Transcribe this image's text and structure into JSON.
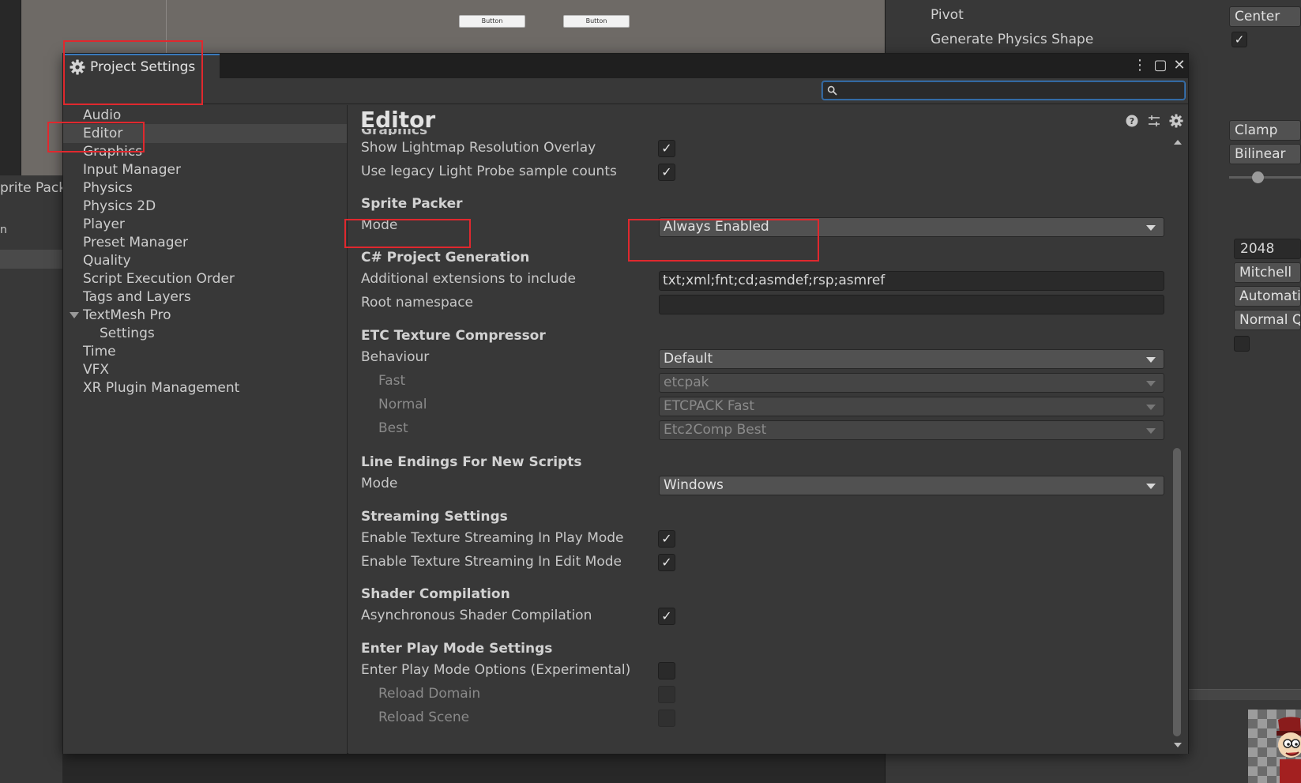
{
  "background": {
    "scene_buttons": [
      "Button",
      "Button"
    ],
    "left_strip_label": "prite Pack",
    "left_strip_tab": "n",
    "inspector": {
      "pivot_label": "Pivot",
      "pivot_value": "Center",
      "physics_shape_label": "Generate Physics Shape",
      "physics_shape_checked": "✓",
      "wrap_value": "Clamp",
      "filter_value": "Bilinear",
      "max_size": "2048",
      "resize": "Mitchell",
      "format": "Automatic",
      "compression": "Normal Q"
    }
  },
  "window": {
    "title": "Project Settings",
    "menu_glyph": "⋮",
    "maximize_glyph": "▢",
    "close_glyph": "✕",
    "search_placeholder": ""
  },
  "sidebar": {
    "items": [
      {
        "label": "Audio"
      },
      {
        "label": "Editor",
        "selected": true
      },
      {
        "label": "Graphics"
      },
      {
        "label": "Input Manager"
      },
      {
        "label": "Physics"
      },
      {
        "label": "Physics 2D"
      },
      {
        "label": "Player"
      },
      {
        "label": "Preset Manager"
      },
      {
        "label": "Quality"
      },
      {
        "label": "Script Execution Order"
      },
      {
        "label": "Tags and Layers"
      },
      {
        "label": "TextMesh Pro"
      },
      {
        "label": "Settings"
      },
      {
        "label": "Time"
      },
      {
        "label": "VFX"
      },
      {
        "label": "XR Plugin Management"
      }
    ]
  },
  "editor": {
    "title": "Editor",
    "cut_section": "Graphics",
    "graphics": {
      "lightmap_overlay": "Show Lightmap Resolution Overlay",
      "legacy_light_probe": "Use legacy Light Probe sample counts"
    },
    "sprite_packer": {
      "header": "Sprite Packer",
      "mode_label": "Mode",
      "mode_value": "Always Enabled"
    },
    "csharp": {
      "header": "C# Project Generation",
      "ext_label": "Additional extensions to include",
      "ext_value": "txt;xml;fnt;cd;asmdef;rsp;asmref",
      "ns_label": "Root namespace",
      "ns_value": ""
    },
    "etc": {
      "header": "ETC Texture Compressor",
      "behaviour_label": "Behaviour",
      "behaviour_value": "Default",
      "fast_label": "Fast",
      "fast_value": "etcpak",
      "normal_label": "Normal",
      "normal_value": "ETCPACK Fast",
      "best_label": "Best",
      "best_value": "Etc2Comp Best"
    },
    "line_endings": {
      "header": "Line Endings For New Scripts",
      "mode_label": "Mode",
      "mode_value": "Windows"
    },
    "streaming": {
      "header": "Streaming Settings",
      "play_label": "Enable Texture Streaming In Play Mode",
      "edit_label": "Enable Texture Streaming In Edit Mode"
    },
    "shader": {
      "header": "Shader Compilation",
      "async_label": "Asynchronous Shader Compilation"
    },
    "play_mode": {
      "header": "Enter Play Mode Settings",
      "options_label": "Enter Play Mode Options (Experimental)",
      "reload_domain_label": "Reload Domain",
      "reload_scene_label": "Reload Scene"
    },
    "check_glyph": "✓"
  },
  "colors": {
    "accent": "#3a79bb",
    "annotation": "#e0282e",
    "window_bg": "#383838",
    "titlebar_bg": "#1f1f1f"
  }
}
